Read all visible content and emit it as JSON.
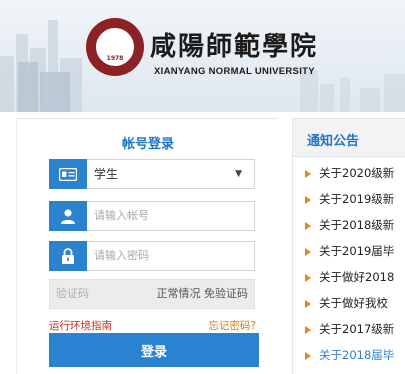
{
  "header": {
    "university_cn": "咸陽師範學院",
    "university_en": "XIANYANG NORMAL UNIVERSITY",
    "seal_year": "1978"
  },
  "login": {
    "title": "帐号登录",
    "role_select": {
      "selected": "学生",
      "icon": "id-card-icon"
    },
    "username": {
      "placeholder": "请输入帐号",
      "icon": "user-icon"
    },
    "password": {
      "placeholder": "请输入密码",
      "icon": "lock-icon"
    },
    "captcha": {
      "placeholder": "验证码",
      "status": "正常情况 免验证码"
    },
    "help_link": "运行环境指南",
    "forgot_link": "忘记密码?",
    "login_button": "登录"
  },
  "notices": {
    "title": "通知公告",
    "items": [
      "关于2020级新",
      "关于2019级新",
      "关于2018级新",
      "关于2019届毕",
      "关于做好2018",
      "关于做好我校",
      "关于2017级新",
      "关于2018届毕"
    ]
  },
  "colors": {
    "accent": "#2b82cf",
    "brand": "#8c2225",
    "warning_link": "#cf2a1f",
    "notice_arrow": "#e38a1c"
  }
}
